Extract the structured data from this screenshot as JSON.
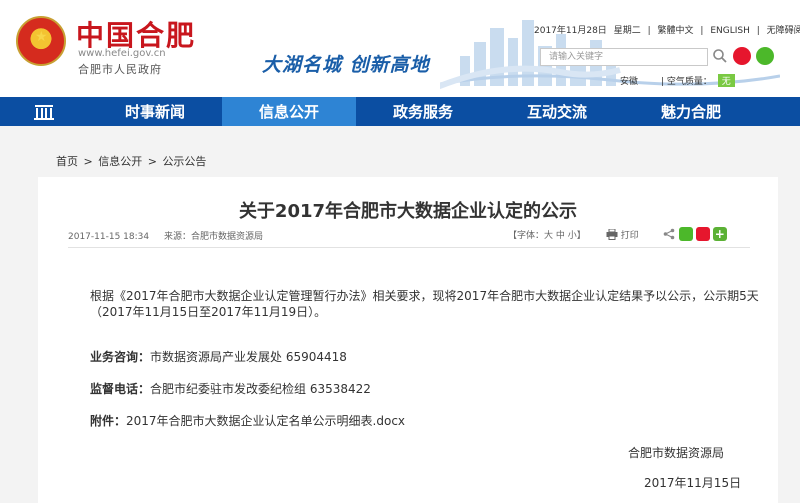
{
  "header": {
    "logo_cn": "中国合肥",
    "logo_url": "www.hefei.gov.cn",
    "logo_name": "合肥市人民政府",
    "slogan": "大湖名城  创新高地",
    "topbar": {
      "date": "2017年11月28日",
      "weekday": "星期二",
      "lang_trad": "繁體中文",
      "lang_en": "ENGLISH",
      "accessibility": "无障碍阅读"
    },
    "search_placeholder": "请输入关键字",
    "weather_city": "安徽",
    "air_quality_label": "空气质量：",
    "air_quality_value": "无"
  },
  "nav": {
    "items": [
      {
        "label": "时事新闻",
        "active": false
      },
      {
        "label": "信息公开",
        "active": true
      },
      {
        "label": "政务服务",
        "active": false
      },
      {
        "label": "互动交流",
        "active": false
      },
      {
        "label": "魅力合肥",
        "active": false
      }
    ]
  },
  "breadcrumb": {
    "home": "首页",
    "sep": ">",
    "level1": "信息公开",
    "level2": "公示公告"
  },
  "article": {
    "title": "关于2017年合肥市大数据企业认定的公示",
    "datetime": "2017-11-15 18:34",
    "source": "来源：合肥市数据资源局",
    "font_label": "【字体：大 中 小】",
    "print_label": "打印",
    "paragraph": "根据《2017年合肥市大数据企业认定管理暂行办法》相关要求，现将2017年合肥市大数据企业认定结果予以公示，公示期5天（2017年11月15日至2017年11月19日）。",
    "consult_label": "业务咨询：",
    "consult_value": "市数据资源局产业发展处 65904418",
    "supervise_label": "监督电话：",
    "supervise_value": "合肥市纪委驻市发改委纪检组 63538422",
    "attach_label": "附件：",
    "attach_value": "2017年合肥市大数据企业认定名单公示明细表.docx",
    "signature": "合肥市数据资源局",
    "sign_date": "2017年11月15日"
  },
  "colors": {
    "brand_red": "#c8161d",
    "nav_blue": "#0b4ea2",
    "nav_active": "#2e84d4",
    "slogan_blue": "#1a5ea8"
  }
}
